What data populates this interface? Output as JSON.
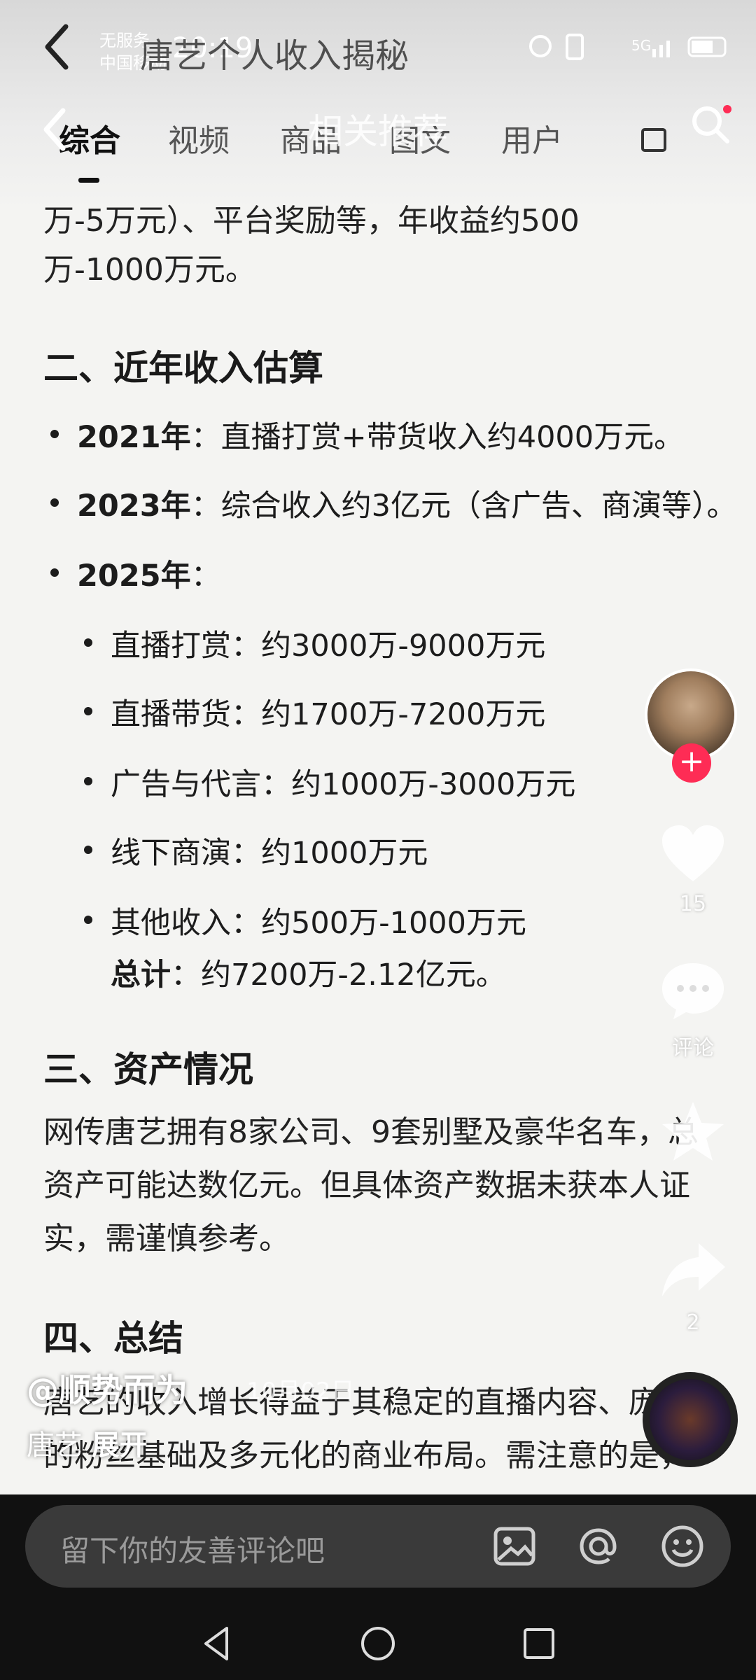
{
  "status_bar": {
    "carrier_line1": "无服务",
    "carrier_line2": "中国移动",
    "time": "20:19"
  },
  "underlay_title": "唐艺个人收入揭秘",
  "tabs": [
    "综合",
    "视频",
    "商品",
    "图文",
    "用户"
  ],
  "overlay_title": "相关推荐",
  "content": {
    "intro_line1": "万-5万元）、平台奖励等，年收益约500",
    "intro_line2": "万-1000万元。",
    "section2_title": "二、近年收入估算",
    "y2021_label": "2021年",
    "y2021_text": "：直播打赏+带货收入约4000万元。",
    "y2023_label": "2023年",
    "y2023_text": "：综合收入约3亿元（含广告、商演等）。",
    "y2025_label": "2025年",
    "y2025_text": "：",
    "items": [
      "直播打赏：约3000万-9000万元",
      "直播带货：约1700万-7200万元",
      "广告与代言：约1000万-3000万元",
      "线下商演：约1000万元",
      "其他收入：约500万-1000万元"
    ],
    "total_label": "总计",
    "total_text": "：约7200万-2.12亿元。",
    "section3_title": "三、资产情况",
    "s3_line1": "网传唐艺拥有8家公司、9套别墅及豪华名车，总",
    "s3_line2": "资产可能达数亿元。但具体资产数据未获本人证",
    "s3_line3": "实，需谨慎参考。",
    "section4_title": "四、总结",
    "s4_line1": "唐艺的收入增长得益于其稳定的直播内容、庞大",
    "s4_line2": "的粉丝基础及多元化的商业布局。需注意的是，"
  },
  "side": {
    "like_count": "15",
    "comment_label": "评论",
    "share_count": "2"
  },
  "author": "@顺势而为",
  "date": "10月02日",
  "desc_text": "唐艺 ",
  "desc_expand": "展开",
  "comment_placeholder": "留下你的友善评论吧",
  "icons": [
    "back-icon",
    "search-icon",
    "heart-icon",
    "comment-icon",
    "star-icon",
    "share-icon",
    "image-icon",
    "at-icon",
    "emoji-icon",
    "nav-back-icon",
    "nav-home-icon",
    "nav-recent-icon"
  ]
}
